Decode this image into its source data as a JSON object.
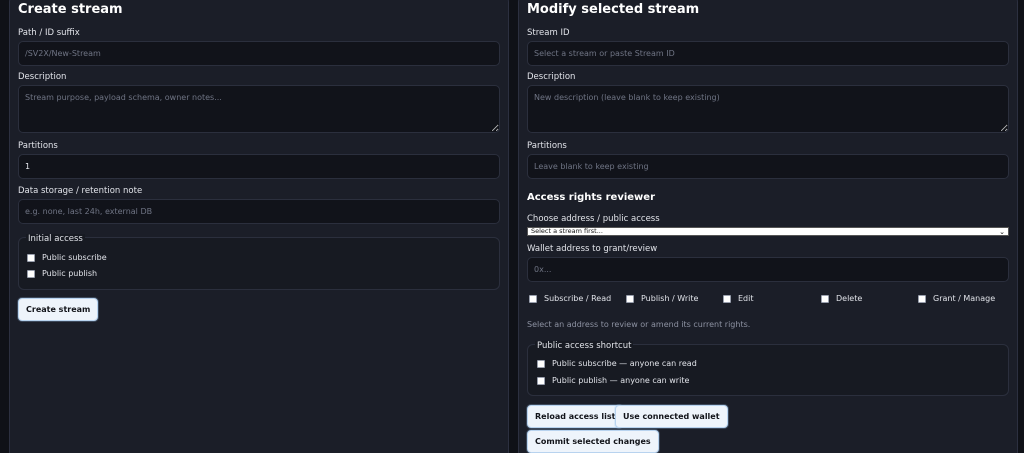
{
  "create": {
    "title": "Create stream",
    "path_label": "Path / ID suffix",
    "path_placeholder": "/SV2X/New-Stream",
    "description_label": "Description",
    "description_placeholder": "Stream purpose, payload schema, owner notes...",
    "partitions_label": "Partitions",
    "partitions_value": "1",
    "storage_label": "Data storage / retention note",
    "storage_placeholder": "e.g. none, last 24h, external DB",
    "initial_access_legend": "Initial access",
    "public_subscribe_label": "Public subscribe",
    "public_publish_label": "Public publish",
    "create_button": "Create stream"
  },
  "modify": {
    "title": "Modify selected stream",
    "stream_id_label": "Stream ID",
    "stream_id_placeholder": "Select a stream or paste Stream ID",
    "description_label": "Description",
    "description_placeholder": "New description (leave blank to keep existing)",
    "partitions_label": "Partitions",
    "partitions_placeholder": "Leave blank to keep existing",
    "access_title": "Access rights reviewer",
    "choose_address_label": "Choose address / public access",
    "choose_address_selected": "Select a stream first...",
    "wallet_label": "Wallet address to grant/review",
    "wallet_placeholder": "0x...",
    "perm_subscribe": "Subscribe / Read",
    "perm_publish": "Publish / Write",
    "perm_edit": "Edit",
    "perm_delete": "Delete",
    "perm_grant": "Grant / Manage",
    "hint": "Select an address to review or amend its current rights.",
    "shortcut_legend": "Public access shortcut",
    "shortcut_subscribe": "Public subscribe — anyone can read",
    "shortcut_publish": "Public publish — anyone can write",
    "reload_button": "Reload access list",
    "use_wallet_button": "Use connected wallet",
    "commit_button": "Commit selected changes"
  }
}
